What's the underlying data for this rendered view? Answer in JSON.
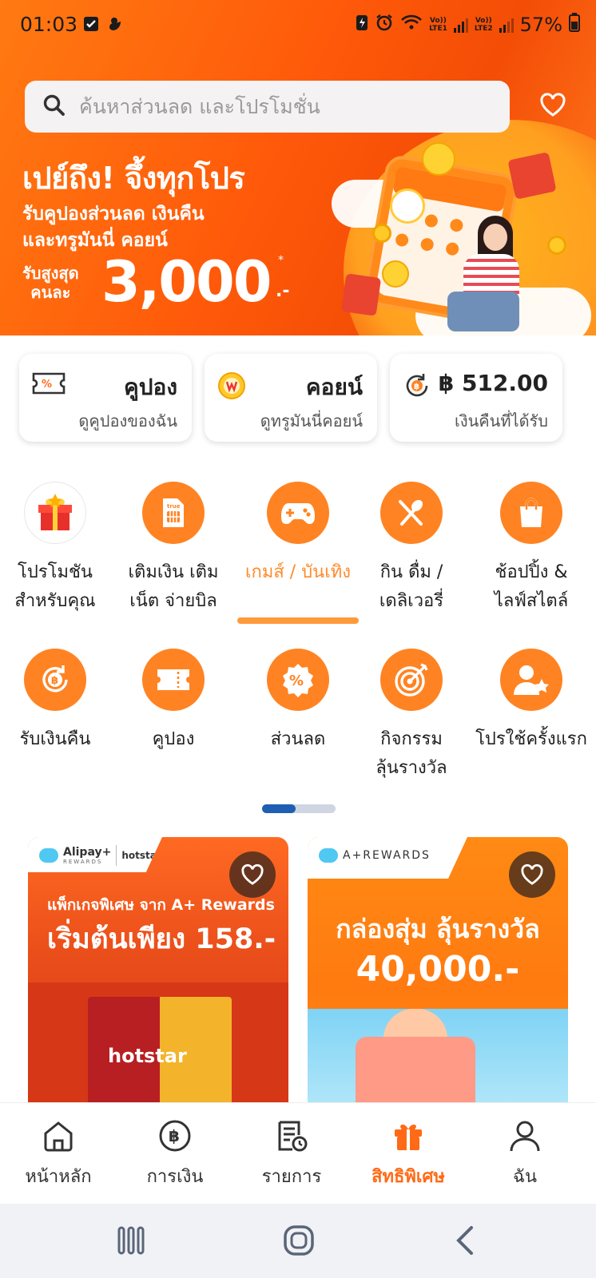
{
  "status_bar": {
    "time": "01:03",
    "battery": "57%",
    "lte1": "LTE1",
    "lte2": "LTE2",
    "volte": "Vo))"
  },
  "search": {
    "placeholder": "ค้นหาส่วนลด และโปรโมชั่น"
  },
  "hero": {
    "title": "เปย์ถึง! จึ้งทุกโปร",
    "subtitle": "รับคูปองส่วนลด เงินคืน\nและทรูมันนี่ คอยน์",
    "up_to": "รับสูงสุด\nคนละ",
    "amount": "3,000",
    "suffix": ".-",
    "star": "*"
  },
  "quick_cards": [
    {
      "title": "คูปอง",
      "subtitle": "ดูคูปองของฉัน",
      "icon": "ticket-icon"
    },
    {
      "title": "คอยน์",
      "subtitle": "ดูทรูมันนี่คอยน์",
      "icon": "coin-icon"
    },
    {
      "title": "฿ 512.00",
      "subtitle": "เงินคืนที่ได้รับ",
      "icon": "cashback-icon"
    }
  ],
  "categories_row1": [
    {
      "label": "โปรโมชัน\nสำหรับคุณ",
      "icon": "gift-box-icon"
    },
    {
      "label": "เติมเงิน เติม\nเน็ต จ่ายบิล",
      "icon": "sim-card-icon"
    },
    {
      "label": "เกมส์ / บันเทิง",
      "icon": "gamepad-icon",
      "active": true
    },
    {
      "label": "กิน ดื่ม /\nเดลิเวอรี่",
      "icon": "fork-spoon-icon"
    },
    {
      "label": "ช้อปปิ้ง &\nไลฟ์สไตล์",
      "icon": "shopping-bag-icon"
    }
  ],
  "categories_row2": [
    {
      "label": "รับเงินคืน",
      "icon": "cashback-icon"
    },
    {
      "label": "คูปอง",
      "icon": "ticket-icon"
    },
    {
      "label": "ส่วนลด",
      "icon": "discount-icon"
    },
    {
      "label": "กิจกรรม\nลุ้นรางวัล",
      "icon": "target-icon"
    },
    {
      "label": "โปรใช้ครั้งแรก",
      "icon": "user-star-icon"
    }
  ],
  "promos": [
    {
      "brand_a": "Alipay+",
      "brand_a_sub": "REWARDS",
      "brand_b": "hotstar",
      "subtitle": "แพ็กเกจพิเศษ จาก A+ Rewards",
      "title": "เริ่มต้นเพียง 158.-",
      "poster_text": "hotstar"
    },
    {
      "brand": "A+REWARDS",
      "title": "กล่องสุ่ม ลุ้นรางวัล",
      "amount": "40,000.-"
    }
  ],
  "bottom_nav": [
    {
      "label": "หน้าหลัก",
      "icon": "home-icon"
    },
    {
      "label": "การเงิน",
      "icon": "baht-icon"
    },
    {
      "label": "รายการ",
      "icon": "receipt-icon"
    },
    {
      "label": "สิทธิพิเศษ",
      "icon": "gift-icon",
      "active": true
    },
    {
      "label": "ฉัน",
      "icon": "user-icon"
    }
  ],
  "colors": {
    "accent": "#ff8322",
    "active_text": "#ff6a16",
    "pager_active": "#1f5fb3"
  }
}
